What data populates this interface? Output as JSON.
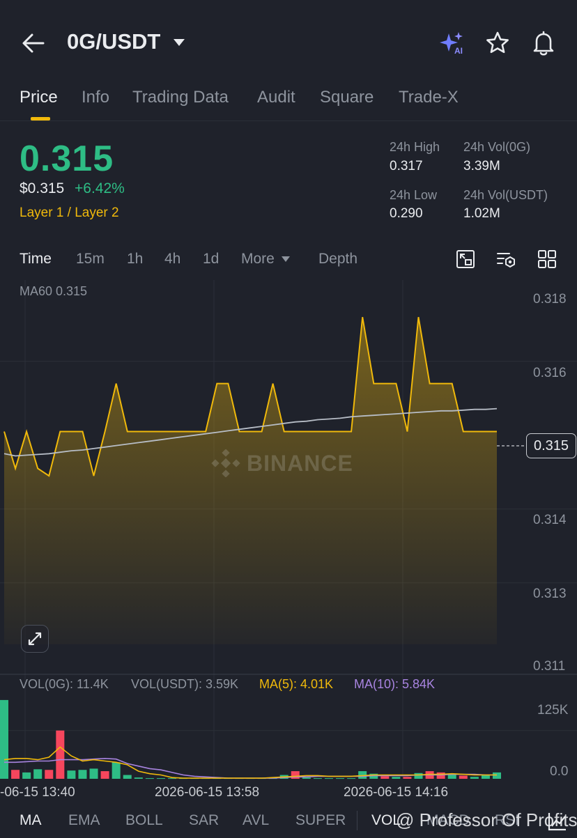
{
  "header": {
    "title": "0G/USDT",
    "ai_badge": "AI",
    "icons": [
      "back-arrow-icon",
      "caret-down-icon",
      "ai-sparkle-icon",
      "star-icon",
      "bell-icon"
    ]
  },
  "tabs": [
    {
      "label": "Price",
      "active": true
    },
    {
      "label": "Info"
    },
    {
      "label": "Trading Data"
    },
    {
      "label": "Audit"
    },
    {
      "label": "Square"
    },
    {
      "label": "Trade-X"
    }
  ],
  "price": {
    "last": "0.315",
    "usd": "$0.315",
    "change": "+6.42%",
    "category": "Layer 1 / Layer 2",
    "high_label": "24h High",
    "high": "0.317",
    "low_label": "24h Low",
    "low": "0.290",
    "vol_base_label": "24h Vol(0G)",
    "vol_base": "3.39M",
    "vol_quote_label": "24h Vol(USDT)",
    "vol_quote": "1.02M"
  },
  "toolbar": {
    "intervals": [
      "Time",
      "15m",
      "1h",
      "4h",
      "1d"
    ],
    "more": "More",
    "depth": "Depth"
  },
  "colors": {
    "up": "#2ebd85",
    "down": "#f6465d",
    "accent": "#f0b90b",
    "ma10": "#a884e0",
    "background": "#1f222b"
  },
  "chart_data": {
    "type": "area",
    "series": [
      {
        "name": "",
        "values": [
          0.31525,
          0.31475,
          0.31525,
          0.31475,
          0.31465,
          0.31525,
          0.31525,
          0.31525,
          0.31465,
          0.31525,
          0.3159,
          0.31525,
          0.31525,
          0.31525,
          0.31525,
          0.31525,
          0.31525,
          0.31525,
          0.31525,
          0.3159,
          0.3159,
          0.31525,
          0.31525,
          0.31525,
          0.3159,
          0.31525,
          0.31525,
          0.31525,
          0.31525,
          0.31525,
          0.31525,
          0.31525,
          0.3168,
          0.3159,
          0.3159,
          0.3159,
          0.31525,
          0.3168,
          0.3159,
          0.3159,
          0.3159,
          0.31525,
          0.31525,
          0.31525,
          0.31525
        ]
      },
      {
        "name": "MA60",
        "values": [
          0.31495,
          0.31492,
          0.31493,
          0.31494,
          0.31495,
          0.31497,
          0.31499,
          0.315,
          0.31502,
          0.31504,
          0.31506,
          0.31508,
          0.3151,
          0.31512,
          0.31514,
          0.31516,
          0.31518,
          0.3152,
          0.31522,
          0.31524,
          0.31526,
          0.31528,
          0.3153,
          0.31532,
          0.31534,
          0.31536,
          0.31538,
          0.31539,
          0.31541,
          0.31542,
          0.31543,
          0.31545,
          0.31546,
          0.31547,
          0.31548,
          0.31549,
          0.3155,
          0.31551,
          0.31552,
          0.31553,
          0.31553,
          0.31554,
          0.31555,
          0.31555,
          0.31556
        ]
      }
    ],
    "ma60_label": "MA60 0.315",
    "current_price": 0.315,
    "y_ticks": [
      "0.318",
      "0.316",
      "0.315",
      "0.314",
      "0.313",
      "0.311"
    ],
    "x_ticks": [
      "-06-15 13:40",
      "2026-06-15 13:58",
      "2026-06-15 14:16"
    ],
    "volume": {
      "bars": [
        124,
        14,
        10,
        15,
        14,
        76,
        13,
        14,
        16,
        12,
        26,
        6,
        2,
        1,
        1,
        1,
        1,
        1,
        1,
        1,
        1,
        1,
        1,
        1,
        1,
        6,
        12,
        2,
        1,
        1,
        1,
        1,
        12,
        8,
        4,
        3,
        3,
        9,
        12,
        10,
        7,
        5,
        3,
        6,
        10
      ],
      "up": [
        true,
        false,
        true,
        true,
        false,
        false,
        true,
        true,
        true,
        false,
        true,
        true,
        true,
        true,
        true,
        true,
        true,
        true,
        true,
        true,
        true,
        true,
        true,
        true,
        true,
        true,
        false,
        true,
        true,
        true,
        true,
        true,
        true,
        true,
        false,
        true,
        false,
        true,
        false,
        false,
        true,
        false,
        true,
        true,
        true
      ],
      "ma5": [
        30,
        32,
        32,
        30,
        34,
        50,
        36,
        28,
        30,
        28,
        26,
        22,
        12,
        8,
        6,
        2,
        1,
        1,
        1,
        1,
        1,
        1,
        1,
        1,
        2,
        3,
        4,
        5,
        5,
        4,
        4,
        4,
        5,
        6,
        6,
        6,
        6,
        6,
        7,
        7,
        8,
        7,
        6,
        6,
        6
      ],
      "ma10": [
        26,
        26,
        27,
        28,
        28,
        30,
        30,
        30,
        31,
        32,
        31,
        24,
        20,
        16,
        14,
        10,
        6,
        4,
        3,
        2,
        1,
        1,
        1,
        1,
        1,
        2,
        3,
        3,
        4,
        4,
        4,
        4,
        4,
        5,
        5,
        5,
        5,
        6,
        6,
        6,
        7,
        7,
        7,
        6,
        6
      ],
      "ylim": [
        0,
        125
      ],
      "y_ticks": [
        "125K",
        "0.0"
      ],
      "legend": {
        "vol_base": "VOL(0G): 11.4K",
        "vol_quote": "VOL(USDT): 3.59K",
        "ma5": "MA(5): 4.01K",
        "ma10": "MA(10): 5.84K"
      }
    }
  },
  "watermark": "BINANCE",
  "indicators": [
    "MA",
    "EMA",
    "BOLL",
    "SAR",
    "AVL",
    "SUPER",
    "VOL",
    "MACD",
    "RSI"
  ],
  "credit": "@ Professor Of Profits"
}
